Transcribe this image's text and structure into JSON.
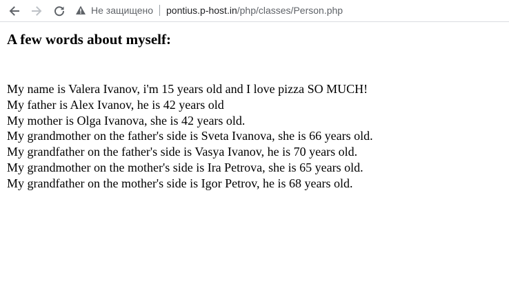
{
  "browser": {
    "security_label": "Не защищено",
    "url_host": "pontius.p-host.in",
    "url_path": "/php/classes/Person.php"
  },
  "page": {
    "heading": "A few words about myself:",
    "lines": [
      "My name is Valera Ivanov, i'm 15 years old and I love pizza SO MUCH!",
      "My father is Alex Ivanov, he is 42 years old",
      "My mother is Olga Ivanova, she is 42 years old.",
      "My grandmother on the father's side is Sveta Ivanova, she is 66 years old.",
      "My grandfather on the father's side is Vasya Ivanov, he is 70 years old.",
      "My grandmother on the mother's side is Ira Petrova, she is 65 years old.",
      "My grandfather on the mother's side is Igor Petrov, he is 68 years old."
    ]
  },
  "icons": {
    "back": "arrow-left-icon",
    "forward": "arrow-right-icon",
    "reload": "reload-icon",
    "warning": "warning-triangle-icon"
  },
  "colors": {
    "toolbar_icon": "#5f6368",
    "forward_disabled": "#bdc1c6",
    "page_text": "#000000"
  }
}
